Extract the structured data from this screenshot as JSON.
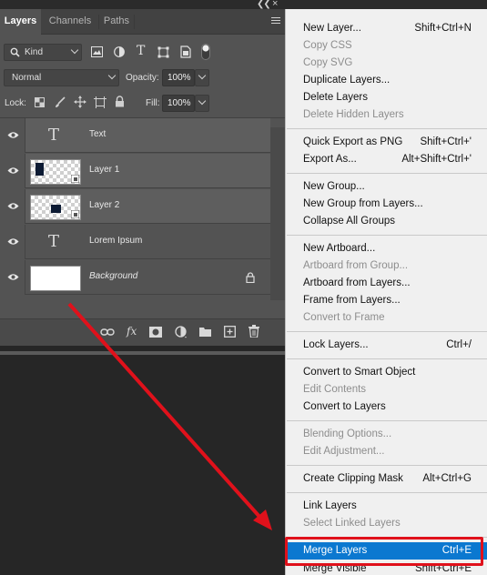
{
  "panel": {
    "tabs": [
      {
        "label": "Layers"
      },
      {
        "label": "Channels"
      },
      {
        "label": "Paths"
      }
    ],
    "filter": {
      "kind_label": "Kind"
    },
    "blend_mode": "Normal",
    "opacity_label": "Opacity:",
    "opacity_value": "100%",
    "lock_label": "Lock:",
    "fill_label": "Fill:",
    "fill_value": "100%"
  },
  "layers": [
    {
      "name": "Text",
      "type": "text"
    },
    {
      "name": "Layer 1",
      "type": "pixel"
    },
    {
      "name": "Layer 2",
      "type": "pixel"
    },
    {
      "name": "Lorem Ipsum",
      "type": "text"
    },
    {
      "name": "Background",
      "type": "background"
    }
  ],
  "footer_icons": [
    "link-icon",
    "fx-icon",
    "mask-icon",
    "adjustment-icon",
    "folder-icon",
    "new-layer-icon",
    "trash-icon"
  ],
  "menu": {
    "items": [
      {
        "label": "New Layer...",
        "shortcut": "Shift+Ctrl+N"
      },
      {
        "label": "Copy CSS",
        "shortcut": ""
      },
      {
        "label": "Copy SVG",
        "shortcut": ""
      },
      {
        "label": "Duplicate Layers...",
        "shortcut": ""
      },
      {
        "label": "Delete Layers",
        "shortcut": ""
      },
      {
        "label": "Delete Hidden Layers",
        "shortcut": ""
      },
      {
        "label": "Quick Export as PNG",
        "shortcut": "Shift+Ctrl+'"
      },
      {
        "label": "Export As...",
        "shortcut": "Alt+Shift+Ctrl+'"
      },
      {
        "label": "New Group...",
        "shortcut": ""
      },
      {
        "label": "New Group from Layers...",
        "shortcut": ""
      },
      {
        "label": "Collapse All Groups",
        "shortcut": ""
      },
      {
        "label": "New Artboard...",
        "shortcut": ""
      },
      {
        "label": "Artboard from Group...",
        "shortcut": ""
      },
      {
        "label": "Artboard from Layers...",
        "shortcut": ""
      },
      {
        "label": "Frame from Layers...",
        "shortcut": ""
      },
      {
        "label": "Convert to Frame",
        "shortcut": ""
      },
      {
        "label": "Lock Layers...",
        "shortcut": "Ctrl+/"
      },
      {
        "label": "Convert to Smart Object",
        "shortcut": ""
      },
      {
        "label": "Edit Contents",
        "shortcut": ""
      },
      {
        "label": "Convert to Layers",
        "shortcut": ""
      },
      {
        "label": "Blending Options...",
        "shortcut": ""
      },
      {
        "label": "Edit Adjustment...",
        "shortcut": ""
      },
      {
        "label": "Create Clipping Mask",
        "shortcut": "Alt+Ctrl+G"
      },
      {
        "label": "Link Layers",
        "shortcut": ""
      },
      {
        "label": "Select Linked Layers",
        "shortcut": ""
      },
      {
        "label": "Merge Layers",
        "shortcut": "Ctrl+E"
      },
      {
        "label": "Merge Visible",
        "shortcut": "Shift+Ctrl+E"
      }
    ],
    "disabled": [
      "Copy CSS",
      "Copy SVG",
      "Delete Hidden Layers",
      "Artboard from Group...",
      "Convert to Frame",
      "Edit Contents",
      "Blending Options...",
      "Edit Adjustment...",
      "Select Linked Layers"
    ],
    "highlighted": "Merge Layers"
  },
  "colors": {
    "highlight": "#0b78d0",
    "annotation_red": "#e0111b",
    "panel_bg": "#535353",
    "menu_bg": "#f0f0f0"
  }
}
